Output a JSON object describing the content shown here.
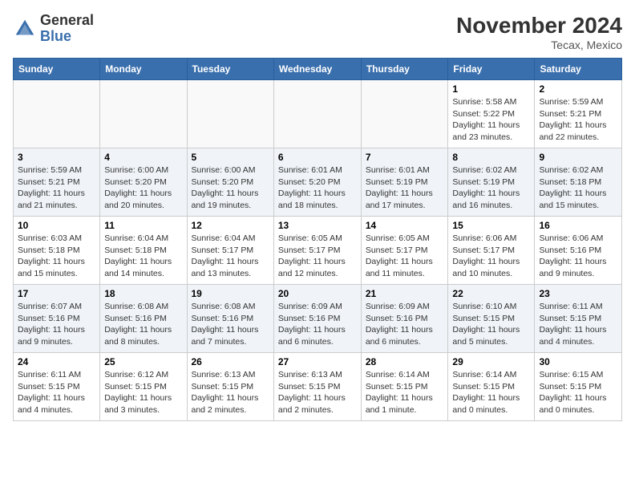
{
  "header": {
    "logo_general": "General",
    "logo_blue": "Blue",
    "month_year": "November 2024",
    "location": "Tecax, Mexico"
  },
  "weekdays": [
    "Sunday",
    "Monday",
    "Tuesday",
    "Wednesday",
    "Thursday",
    "Friday",
    "Saturday"
  ],
  "weeks": [
    [
      {
        "day": "",
        "info": ""
      },
      {
        "day": "",
        "info": ""
      },
      {
        "day": "",
        "info": ""
      },
      {
        "day": "",
        "info": ""
      },
      {
        "day": "",
        "info": ""
      },
      {
        "day": "1",
        "info": "Sunrise: 5:58 AM\nSunset: 5:22 PM\nDaylight: 11 hours and 23 minutes."
      },
      {
        "day": "2",
        "info": "Sunrise: 5:59 AM\nSunset: 5:21 PM\nDaylight: 11 hours and 22 minutes."
      }
    ],
    [
      {
        "day": "3",
        "info": "Sunrise: 5:59 AM\nSunset: 5:21 PM\nDaylight: 11 hours and 21 minutes."
      },
      {
        "day": "4",
        "info": "Sunrise: 6:00 AM\nSunset: 5:20 PM\nDaylight: 11 hours and 20 minutes."
      },
      {
        "day": "5",
        "info": "Sunrise: 6:00 AM\nSunset: 5:20 PM\nDaylight: 11 hours and 19 minutes."
      },
      {
        "day": "6",
        "info": "Sunrise: 6:01 AM\nSunset: 5:20 PM\nDaylight: 11 hours and 18 minutes."
      },
      {
        "day": "7",
        "info": "Sunrise: 6:01 AM\nSunset: 5:19 PM\nDaylight: 11 hours and 17 minutes."
      },
      {
        "day": "8",
        "info": "Sunrise: 6:02 AM\nSunset: 5:19 PM\nDaylight: 11 hours and 16 minutes."
      },
      {
        "day": "9",
        "info": "Sunrise: 6:02 AM\nSunset: 5:18 PM\nDaylight: 11 hours and 15 minutes."
      }
    ],
    [
      {
        "day": "10",
        "info": "Sunrise: 6:03 AM\nSunset: 5:18 PM\nDaylight: 11 hours and 15 minutes."
      },
      {
        "day": "11",
        "info": "Sunrise: 6:04 AM\nSunset: 5:18 PM\nDaylight: 11 hours and 14 minutes."
      },
      {
        "day": "12",
        "info": "Sunrise: 6:04 AM\nSunset: 5:17 PM\nDaylight: 11 hours and 13 minutes."
      },
      {
        "day": "13",
        "info": "Sunrise: 6:05 AM\nSunset: 5:17 PM\nDaylight: 11 hours and 12 minutes."
      },
      {
        "day": "14",
        "info": "Sunrise: 6:05 AM\nSunset: 5:17 PM\nDaylight: 11 hours and 11 minutes."
      },
      {
        "day": "15",
        "info": "Sunrise: 6:06 AM\nSunset: 5:17 PM\nDaylight: 11 hours and 10 minutes."
      },
      {
        "day": "16",
        "info": "Sunrise: 6:06 AM\nSunset: 5:16 PM\nDaylight: 11 hours and 9 minutes."
      }
    ],
    [
      {
        "day": "17",
        "info": "Sunrise: 6:07 AM\nSunset: 5:16 PM\nDaylight: 11 hours and 9 minutes."
      },
      {
        "day": "18",
        "info": "Sunrise: 6:08 AM\nSunset: 5:16 PM\nDaylight: 11 hours and 8 minutes."
      },
      {
        "day": "19",
        "info": "Sunrise: 6:08 AM\nSunset: 5:16 PM\nDaylight: 11 hours and 7 minutes."
      },
      {
        "day": "20",
        "info": "Sunrise: 6:09 AM\nSunset: 5:16 PM\nDaylight: 11 hours and 6 minutes."
      },
      {
        "day": "21",
        "info": "Sunrise: 6:09 AM\nSunset: 5:16 PM\nDaylight: 11 hours and 6 minutes."
      },
      {
        "day": "22",
        "info": "Sunrise: 6:10 AM\nSunset: 5:15 PM\nDaylight: 11 hours and 5 minutes."
      },
      {
        "day": "23",
        "info": "Sunrise: 6:11 AM\nSunset: 5:15 PM\nDaylight: 11 hours and 4 minutes."
      }
    ],
    [
      {
        "day": "24",
        "info": "Sunrise: 6:11 AM\nSunset: 5:15 PM\nDaylight: 11 hours and 4 minutes."
      },
      {
        "day": "25",
        "info": "Sunrise: 6:12 AM\nSunset: 5:15 PM\nDaylight: 11 hours and 3 minutes."
      },
      {
        "day": "26",
        "info": "Sunrise: 6:13 AM\nSunset: 5:15 PM\nDaylight: 11 hours and 2 minutes."
      },
      {
        "day": "27",
        "info": "Sunrise: 6:13 AM\nSunset: 5:15 PM\nDaylight: 11 hours and 2 minutes."
      },
      {
        "day": "28",
        "info": "Sunrise: 6:14 AM\nSunset: 5:15 PM\nDaylight: 11 hours and 1 minute."
      },
      {
        "day": "29",
        "info": "Sunrise: 6:14 AM\nSunset: 5:15 PM\nDaylight: 11 hours and 0 minutes."
      },
      {
        "day": "30",
        "info": "Sunrise: 6:15 AM\nSunset: 5:15 PM\nDaylight: 11 hours and 0 minutes."
      }
    ]
  ]
}
